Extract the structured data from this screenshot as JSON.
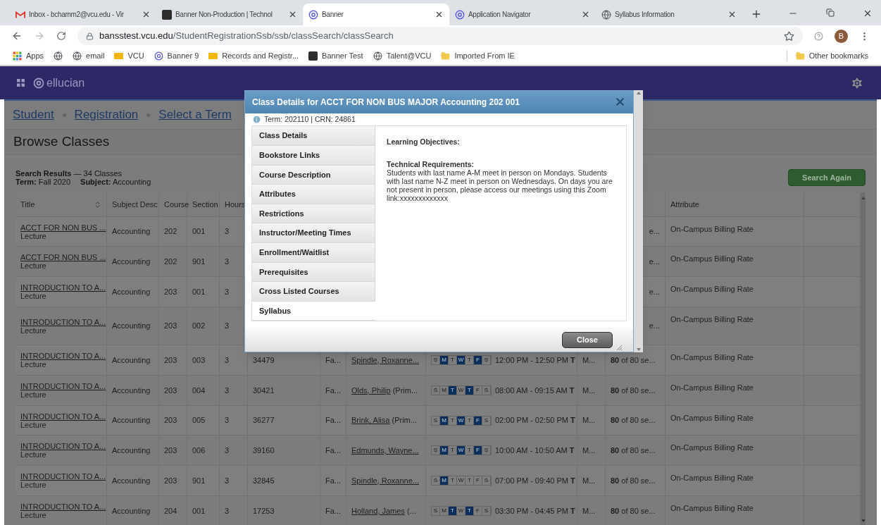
{
  "browser": {
    "tabs": [
      {
        "title": "Inbox - bchamm2@vcu.edu - Vir",
        "kind": "mail",
        "selected": false
      },
      {
        "title": "Banner Non-Production | Technol",
        "kind": "ts",
        "selected": false
      },
      {
        "title": "Banner",
        "kind": "banner",
        "selected": true
      },
      {
        "title": "Application Navigator",
        "kind": "banner",
        "selected": false
      },
      {
        "title": "Syllabus Information",
        "kind": "web",
        "selected": false
      }
    ],
    "url": {
      "host": "bansstest.vcu.edu",
      "path": "/StudentRegistrationSsb/ssb/classSearch/classSearch"
    },
    "avatar": "B",
    "bookmarks": [
      {
        "label": "Apps",
        "kind": "apps"
      },
      {
        "kind": "web"
      },
      {
        "label": "email",
        "kind": "web"
      },
      {
        "label": "VCU",
        "kind": "vcu"
      },
      {
        "label": "Banner 9",
        "kind": "banner"
      },
      {
        "label": "Records and Registr...",
        "kind": "vcu"
      },
      {
        "label": "Banner Test",
        "kind": "ts"
      },
      {
        "label": "Talent@VCU",
        "kind": "web"
      },
      {
        "label": "Imported From IE",
        "kind": "folder"
      }
    ],
    "other_bookmarks": "Other bookmarks"
  },
  "app": {
    "brand": "ellucian",
    "breadcrumb": [
      "Student",
      "Registration",
      "Select a Term"
    ],
    "heading": "Browse Classes"
  },
  "results": {
    "summary": "**Search Results** — 34 Classes",
    "term": "**Term:** Fall 2020",
    "subject": "**Subject:** Accounting",
    "search_again": "Search Again"
  },
  "table": {
    "columns_left": [
      {
        "label": "Title",
        "sort": true
      },
      {
        "label": "Subject Desc"
      },
      {
        "label": "Course"
      },
      {
        "label": "Section"
      },
      {
        "label": "Hours"
      }
    ],
    "columns_right": [
      {
        "label": "Attribute"
      }
    ],
    "rows": [
      {
        "title": "ACCT FOR NON BUS ...",
        "type": "Lecture",
        "subject": "Accounting",
        "course": "202",
        "section": "001",
        "hours": "3",
        "status_tail": "e...",
        "attribute": "On-Campus Billing Rate"
      },
      {
        "title": "ACCT FOR NON BUS ...",
        "type": "Lecture",
        "subject": "Accounting",
        "course": "202",
        "section": "901",
        "hours": "3",
        "status_tail": "e...",
        "attribute": "On-Campus Billing Rate"
      },
      {
        "title": "INTRODUCTION TO A...",
        "type": "Lecture",
        "subject": "Accounting",
        "course": "203",
        "section": "001",
        "hours": "3",
        "status_tail": "e...",
        "attribute": "On-Campus Billing Rate"
      },
      {
        "title": "INTRODUCTION TO A...",
        "type": "Lecture",
        "subject": "Accounting",
        "course": "203",
        "section": "002",
        "hours": "3",
        "status_tail": "e...",
        "attribute": "On-Campus Billing Rate"
      },
      {
        "title": "INTRODUCTION TO A...",
        "type": "Lecture",
        "subject": "Accounting",
        "course": "203",
        "section": "003",
        "hours": "3",
        "crn": "34479",
        "term": "Fa...",
        "instructor": {
          "name": "Spindle, Roxanne..."
        },
        "days": [
          {
            "label": "S",
            "selected": false
          },
          {
            "label": "M",
            "selected": true
          },
          {
            "label": "T",
            "selected": false
          },
          {
            "label": "W",
            "selected": true
          },
          {
            "label": "T",
            "selected": false
          },
          {
            "label": "F",
            "selected": true
          },
          {
            "label": "S",
            "selected": false
          }
        ],
        "time": "12:00 PM - 12:50 PM **T**",
        "campus": "M...",
        "status": "**80** of 80 se...",
        "attribute": "On-Campus Billing Rate"
      },
      {
        "title": "INTRODUCTION TO A...",
        "type": "Lecture",
        "subject": "Accounting",
        "course": "203",
        "section": "004",
        "hours": "3",
        "crn": "30421",
        "term": "Fa...",
        "instructor": {
          "name": "Olds, Philip",
          "suffix": " (Prim..."
        },
        "days": [
          {
            "label": "S",
            "selected": false
          },
          {
            "label": "M",
            "selected": false
          },
          {
            "label": "T",
            "selected": true
          },
          {
            "label": "W",
            "selected": false
          },
          {
            "label": "T",
            "selected": true
          },
          {
            "label": "F",
            "selected": false
          },
          {
            "label": "S",
            "selected": false
          }
        ],
        "time": "08:00 AM - 09:15 AM **T**",
        "campus": "M...",
        "status": "**80** of 80 se...",
        "attribute": "On-Campus Billing Rate"
      },
      {
        "title": "INTRODUCTION TO A...",
        "type": "Lecture",
        "subject": "Accounting",
        "course": "203",
        "section": "005",
        "hours": "3",
        "crn": "36277",
        "term": "Fa...",
        "instructor": {
          "name": "Brink, Alisa",
          "suffix": " (Prim..."
        },
        "days": [
          {
            "label": "S",
            "selected": false
          },
          {
            "label": "M",
            "selected": true
          },
          {
            "label": "T",
            "selected": false
          },
          {
            "label": "W",
            "selected": true
          },
          {
            "label": "T",
            "selected": false
          },
          {
            "label": "F",
            "selected": true
          },
          {
            "label": "S",
            "selected": false
          }
        ],
        "time": "02:00 PM - 02:50 PM **T**",
        "campus": "M...",
        "status": "**80** of 80 se...",
        "attribute": "On-Campus Billing Rate"
      },
      {
        "title": "INTRODUCTION TO A...",
        "type": "Lecture",
        "subject": "Accounting",
        "course": "203",
        "section": "006",
        "hours": "3",
        "crn": "39160",
        "term": "Fa...",
        "instructor": {
          "name": "Edmunds, Wayne..."
        },
        "days": [
          {
            "label": "S",
            "selected": false
          },
          {
            "label": "M",
            "selected": true
          },
          {
            "label": "T",
            "selected": false
          },
          {
            "label": "W",
            "selected": true
          },
          {
            "label": "T",
            "selected": false
          },
          {
            "label": "F",
            "selected": true
          },
          {
            "label": "S",
            "selected": false
          }
        ],
        "time": "10:00 AM - 10:50 AM **T**",
        "campus": "M...",
        "status": "**80** of 80 se...",
        "attribute": "On-Campus Billing Rate"
      },
      {
        "title": "INTRODUCTION TO A...",
        "type": "Lecture",
        "subject": "Accounting",
        "course": "203",
        "section": "901",
        "hours": "3",
        "crn": "32845",
        "term": "Fa...",
        "instructor": {
          "name": "Spindle, Roxanne..."
        },
        "days": [
          {
            "label": "S",
            "selected": false
          },
          {
            "label": "M",
            "selected": true
          },
          {
            "label": "T",
            "selected": false
          },
          {
            "label": "W",
            "selected": false
          },
          {
            "label": "T",
            "selected": false
          },
          {
            "label": "F",
            "selected": false
          },
          {
            "label": "S",
            "selected": false
          }
        ],
        "time": "07:00 PM - 09:40 PM **T**",
        "campus": "M...",
        "status": "**80** of 80 se...",
        "attribute": "On-Campus Billing Rate"
      },
      {
        "title": "INTRODUCTION TO A...",
        "type": "Lecture",
        "subject": "Accounting",
        "course": "204",
        "section": "001",
        "hours": "3",
        "crn": "17253",
        "term": "Fa...",
        "instructor": {
          "name": "Holland, James",
          "suffix": " (..."
        },
        "days": [
          {
            "label": "S",
            "selected": false
          },
          {
            "label": "M",
            "selected": false
          },
          {
            "label": "T",
            "selected": true
          },
          {
            "label": "W",
            "selected": false
          },
          {
            "label": "T",
            "selected": true
          },
          {
            "label": "F",
            "selected": false
          },
          {
            "label": "S",
            "selected": false
          }
        ],
        "time": "03:30 PM - 04:45 PM **T**",
        "campus": "M...",
        "status": "**80** of 80 se...",
        "attribute": "On-Campus Billing Rate"
      }
    ]
  },
  "dialog": {
    "title": "Class Details for ACCT FOR NON BUS MAJOR Accounting 202 001",
    "info": "Term: 202110 | CRN: 24861",
    "tabs": [
      {
        "label": "Class Details",
        "selected": false
      },
      {
        "label": "Bookstore Links",
        "selected": false
      },
      {
        "label": "Course Description",
        "selected": false
      },
      {
        "label": "Attributes",
        "selected": false
      },
      {
        "label": "Restrictions",
        "selected": false
      },
      {
        "label": "Instructor/Meeting Times",
        "selected": false
      },
      {
        "label": "Enrollment/Waitlist",
        "selected": false
      },
      {
        "label": "Prerequisites",
        "selected": false
      },
      {
        "label": "Cross Listed Courses",
        "selected": false
      },
      {
        "label": "Syllabus",
        "selected": true
      }
    ],
    "sections": [
      {
        "heading": "Learning Objectives:"
      },
      {
        "heading": "Technical Requirements:",
        "text": "Students with last name A-M meet in person on Mondays. Students with last name N-Z meet in person on Wednesdays. On days you are not present in person, please access our meetings using this Zoom link:xxxxxxxxxxxxx"
      }
    ],
    "close": "Close"
  }
}
